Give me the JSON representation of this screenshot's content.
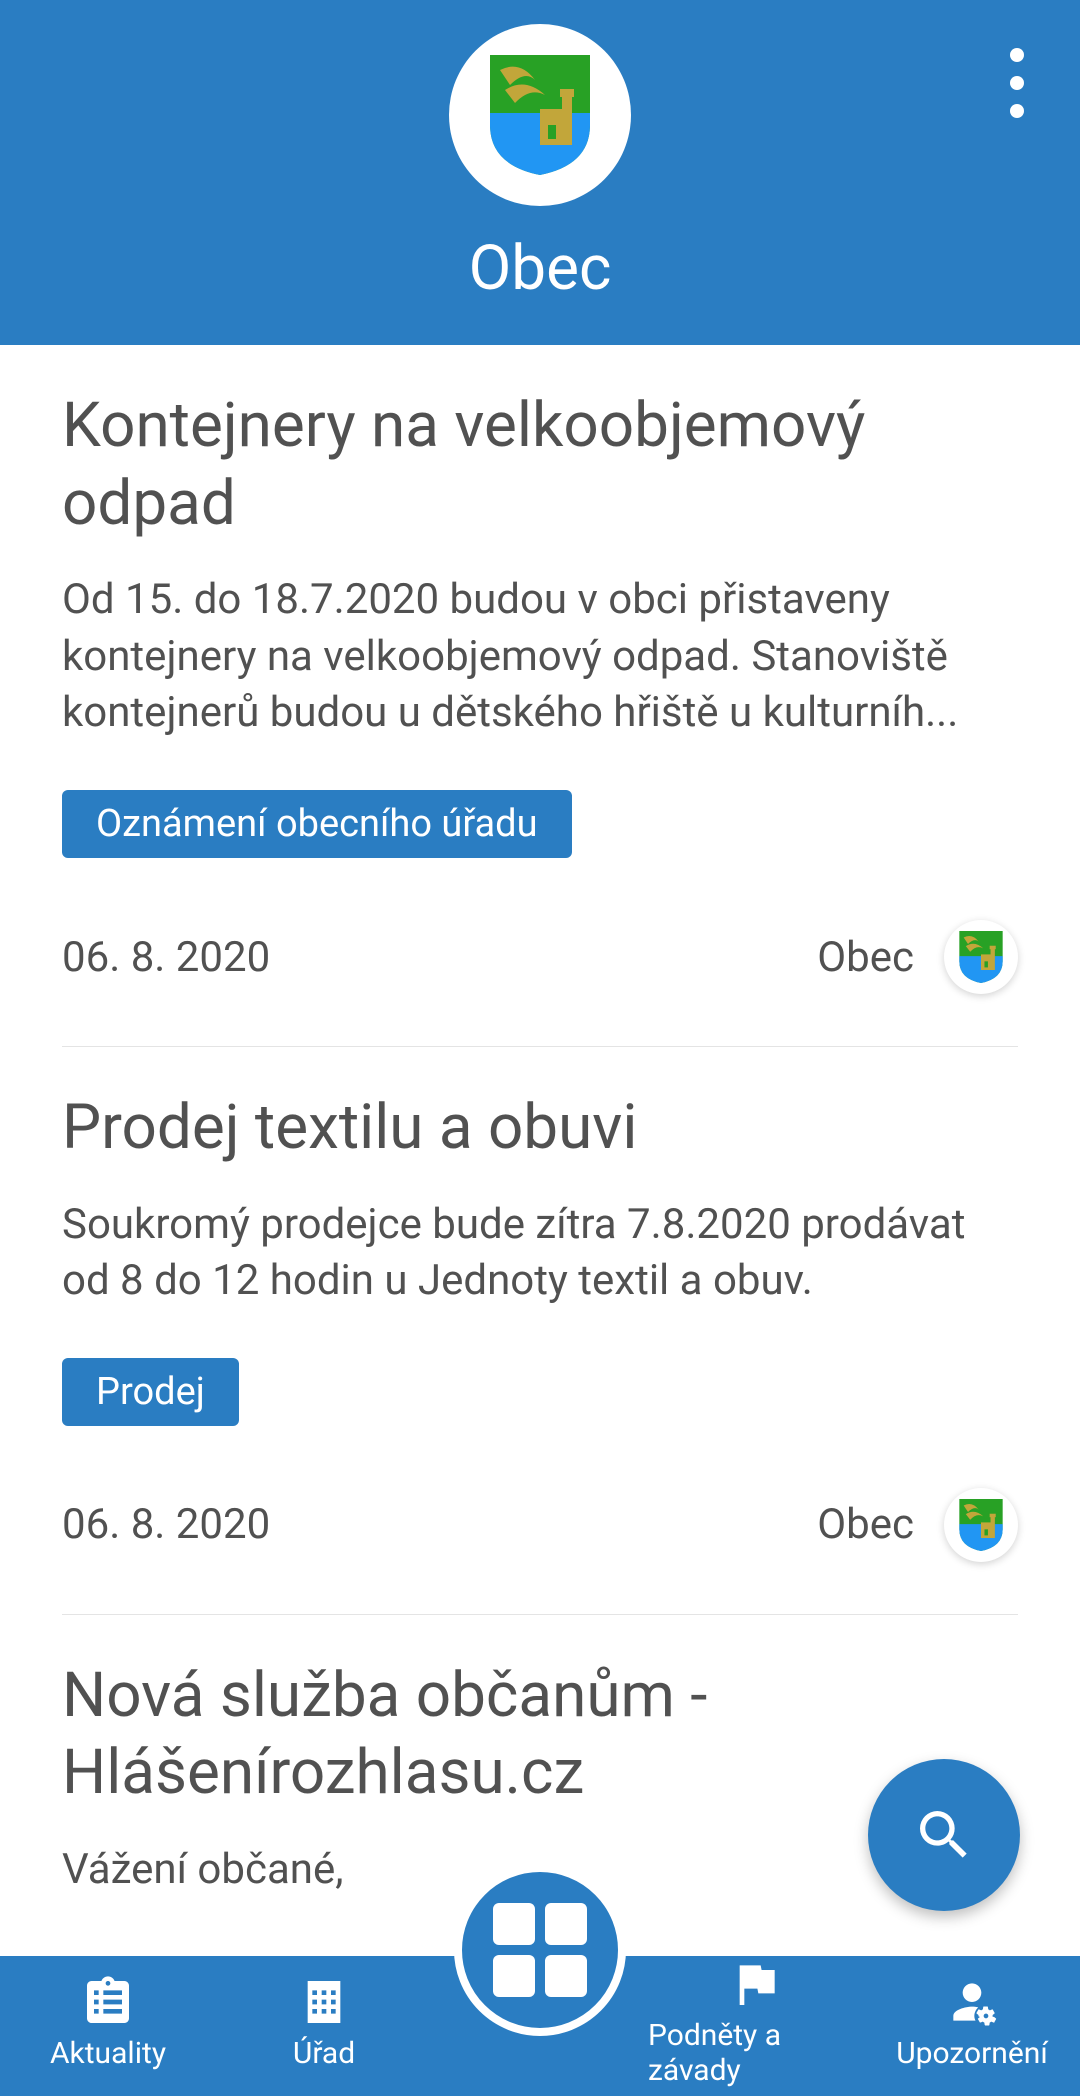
{
  "header": {
    "title": "Obec"
  },
  "articles": [
    {
      "title": "Kontejnery na velkoobjemový odpad",
      "excerpt": "Od 15. do 18.7.2020 budou v obci přistaveny kontejnery na velkoobjemový odpad. Stanoviště kontejnerů budou u dětského hřiště u kulturníh...",
      "tag": "Oznámení obecního úřadu",
      "date": "06. 8. 2020",
      "source": "Obec"
    },
    {
      "title": "Prodej textilu a obuvi",
      "excerpt": "Soukromý prodejce bude zítra 7.8.2020 prodávat od 8 do 12 hodin u Jednoty textil a obuv.",
      "tag": "Prodej",
      "date": "06. 8. 2020",
      "source": "Obec"
    },
    {
      "title": "Nová služba občanům - Hlášenírozhlasu.cz",
      "excerpt": "Vážení občané,"
    }
  ],
  "nav": {
    "aktuality": "Aktuality",
    "urad": "Úřad",
    "podnety": "Podněty a závady",
    "upozorneni": "Upozornění"
  }
}
